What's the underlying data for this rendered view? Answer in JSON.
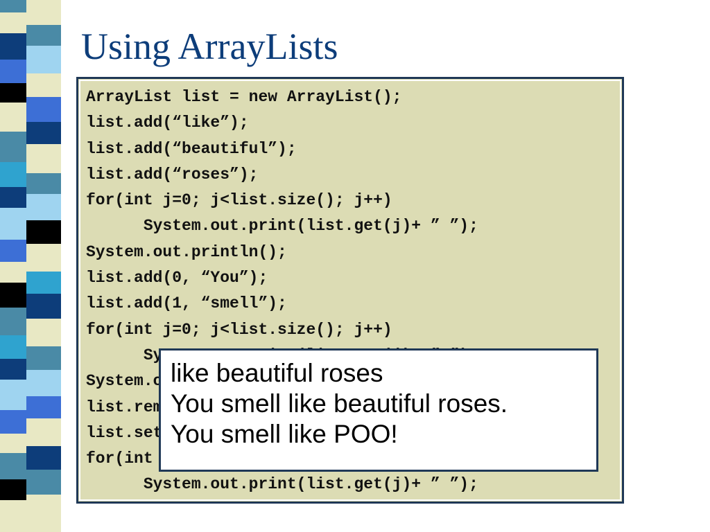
{
  "slide": {
    "title": "Using ArrayLists"
  },
  "code": {
    "lines": [
      "ArrayList list = new ArrayList();",
      "list.add(“like”);",
      "list.add(“beautiful”);",
      "list.add(“roses”);",
      "for(int j=0; j<list.size(); j++)",
      "      System.out.print(list.get(j)+ ” ”);",
      "System.out.println();",
      "list.add(0, “You”);",
      "list.add(1, “smell”);",
      "for(int j=0; j<list.size(); j++)",
      "      System.out.print(list.get(j)+ ” ”);",
      "System.out.println(”.”);",
      "list.remove(4);",
      "list.set(3, “POO!”);",
      "for(int j=0; j<list.size(); j++)",
      "      System.out.print(list.get(j)+ ” ”);"
    ]
  },
  "output": {
    "lines": [
      "like beautiful roses",
      "You smell like beautiful roses.",
      "You smell like POO!"
    ]
  },
  "colors": {
    "title": "#0d3d7a",
    "code_background": "#dcdcb4",
    "box_border": "#1f3857",
    "strip_navy": "#0d3d7a",
    "strip_blue": "#3d6fd6",
    "strip_teal": "#4a8aa6",
    "strip_cyan": "#2fa3cf",
    "strip_light": "#9fd4f0",
    "strip_cream": "#e8e8c4",
    "strip_black": "#000000"
  }
}
